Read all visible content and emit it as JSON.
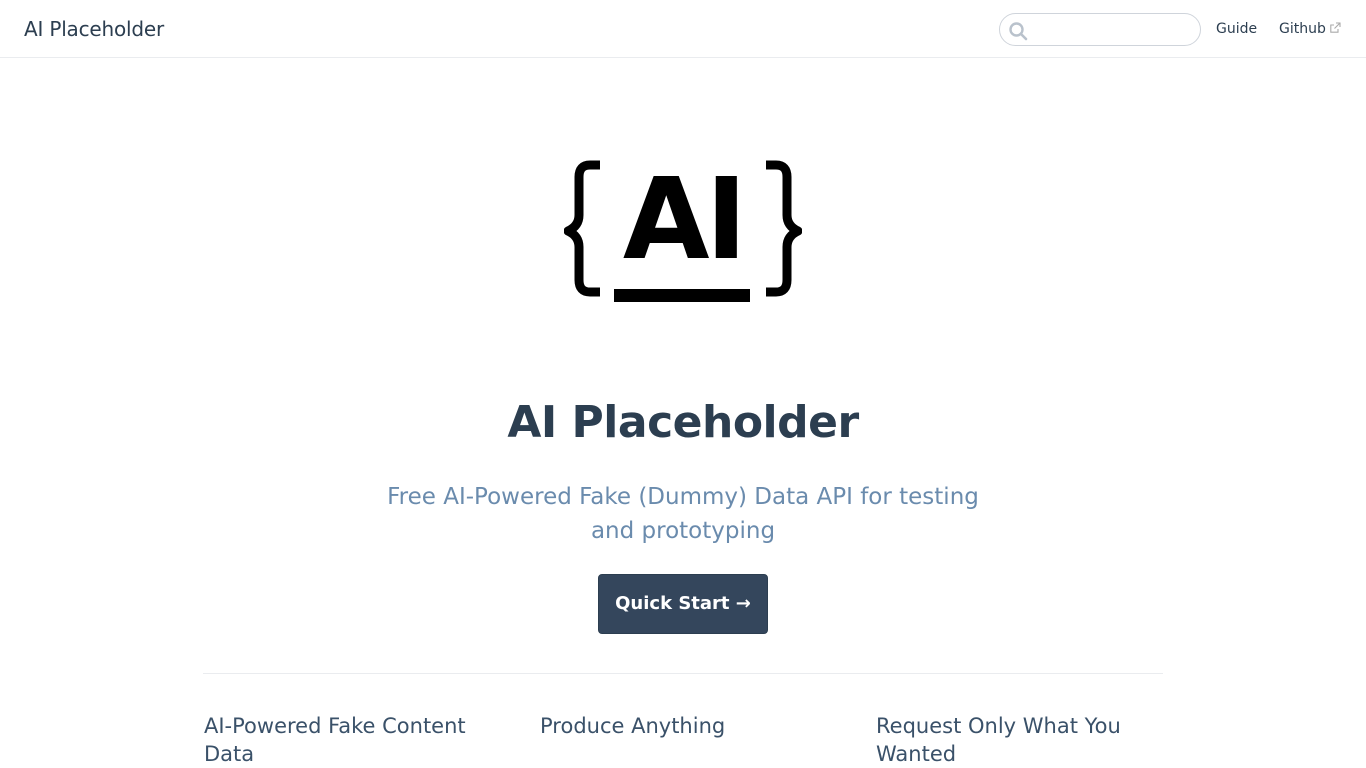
{
  "navbar": {
    "site_name": "AI Placeholder",
    "search": {
      "value": "",
      "placeholder": "",
      "icon": "search-icon"
    },
    "links": [
      {
        "label": "Guide"
      },
      {
        "label": "Github",
        "icon": "external-link-icon"
      }
    ]
  },
  "hero": {
    "logo_text": "AI",
    "title": "AI Placeholder",
    "description": "Free AI-Powered Fake (Dummy) Data API for testing and prototyping",
    "action_label": "Quick Start →"
  },
  "features": [
    {
      "title": "AI-Powered Fake Content Data"
    },
    {
      "title": "Produce Anything"
    },
    {
      "title": "Request Only What You Wanted"
    }
  ],
  "colors": {
    "text": "#2c3e50",
    "description": "#6a8bad",
    "button_bg": "#34465c",
    "border": "#eaecef"
  }
}
